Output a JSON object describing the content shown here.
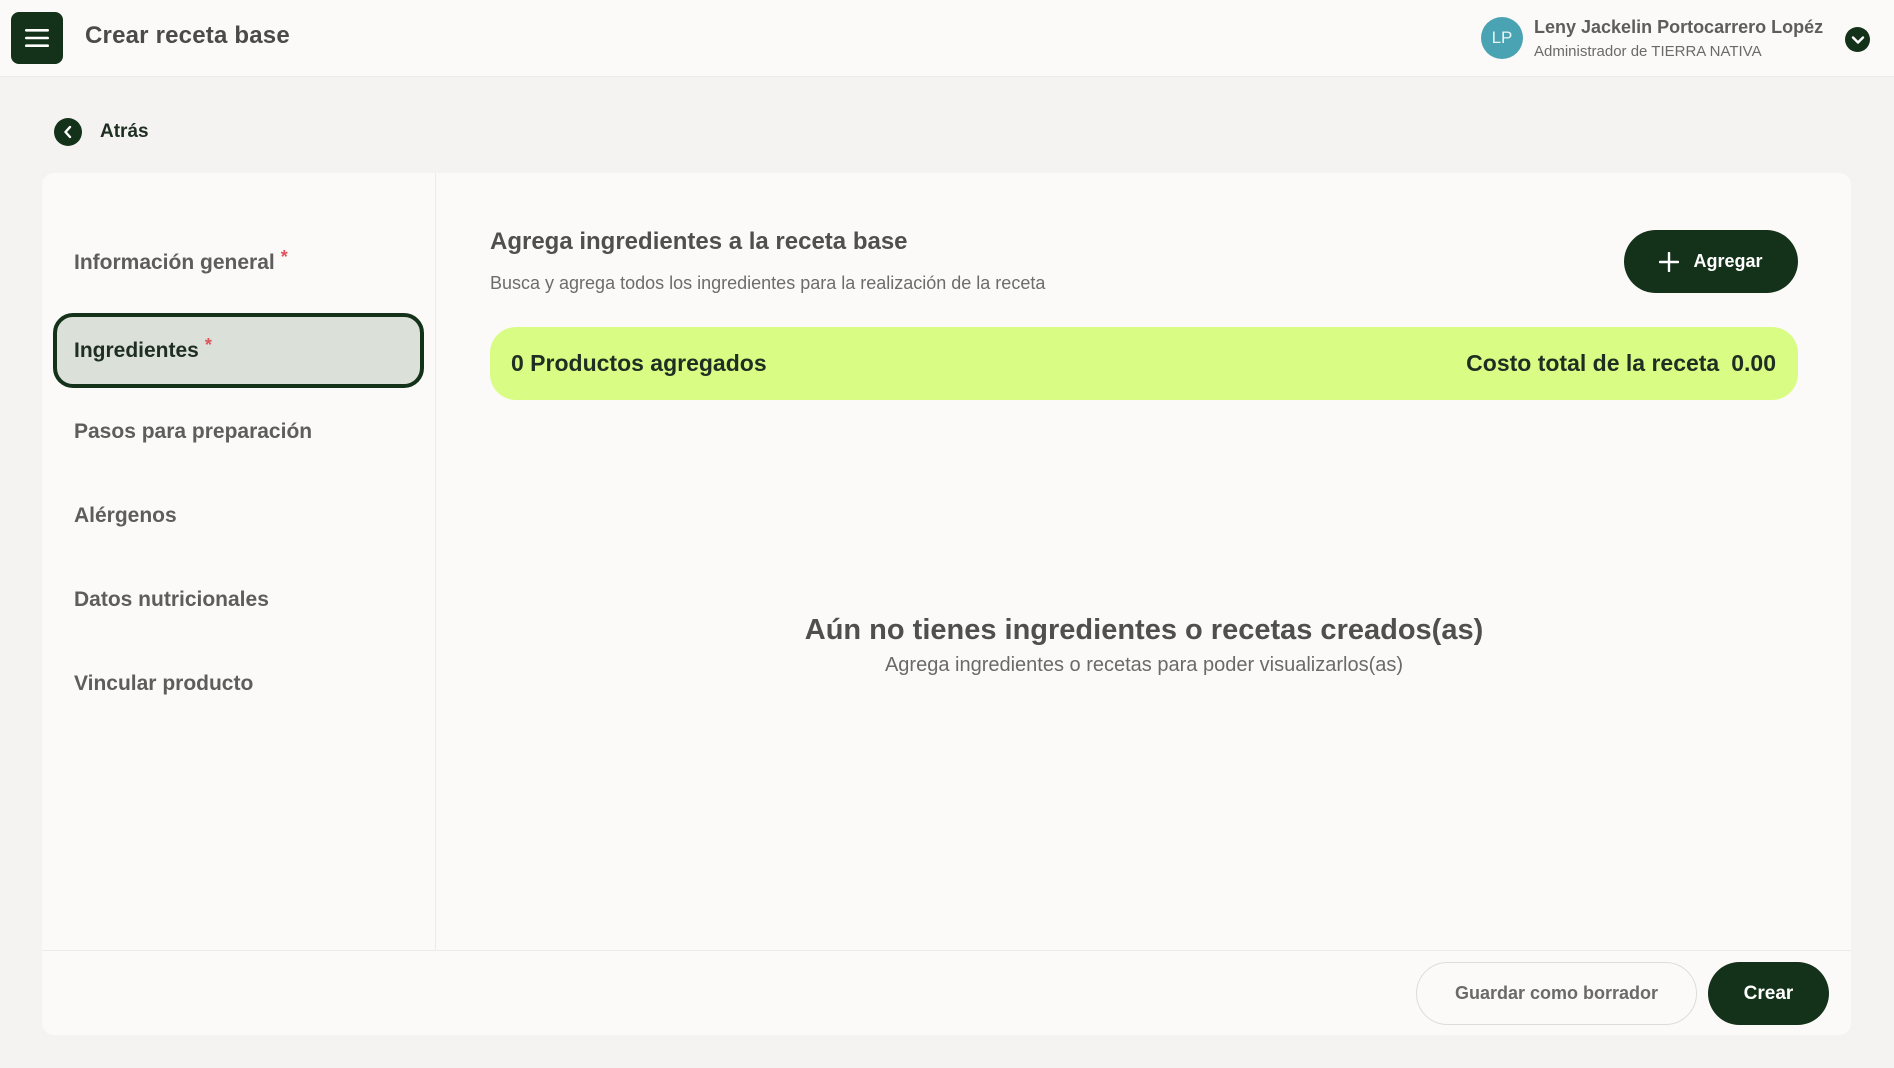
{
  "header": {
    "title": "Crear receta base",
    "menu_icon": "hamburger-menu-icon",
    "user": {
      "initials": "LP",
      "name": "Leny Jackelin Portocarrero Lopéz",
      "role": "Administrador de TIERRA NATIVA",
      "avatar_color": "#4aa3b3"
    }
  },
  "back": {
    "label": "Atrás"
  },
  "sidebar": {
    "items": [
      {
        "label": "Información general",
        "required": "*"
      },
      {
        "label": "Ingredientes",
        "required": "*"
      },
      {
        "label": "Pasos para preparación"
      },
      {
        "label": "Alérgenos"
      },
      {
        "label": "Datos nutricionales"
      },
      {
        "label": "Vincular producto"
      }
    ],
    "active_index": 1
  },
  "content": {
    "title": "Agrega ingredientes a la receta base",
    "subtitle": "Busca y agrega todos los ingredientes para la realización de la receta",
    "add_button": "Agregar",
    "summary": {
      "products_label": "0 Productos agregados",
      "total_label": "Costo total de la receta",
      "total_value": "0.00"
    },
    "empty_state": {
      "title": "Aún no tienes ingredientes o recetas creados(as)",
      "subtitle": "Agrega ingredientes o recetas para poder visualizarlos(as)"
    }
  },
  "footer": {
    "draft_button": "Guardar como borrador",
    "create_button": "Crear"
  },
  "colors": {
    "primary": "#14321a",
    "highlight": "#d9fc84",
    "required": "#e0525a"
  }
}
